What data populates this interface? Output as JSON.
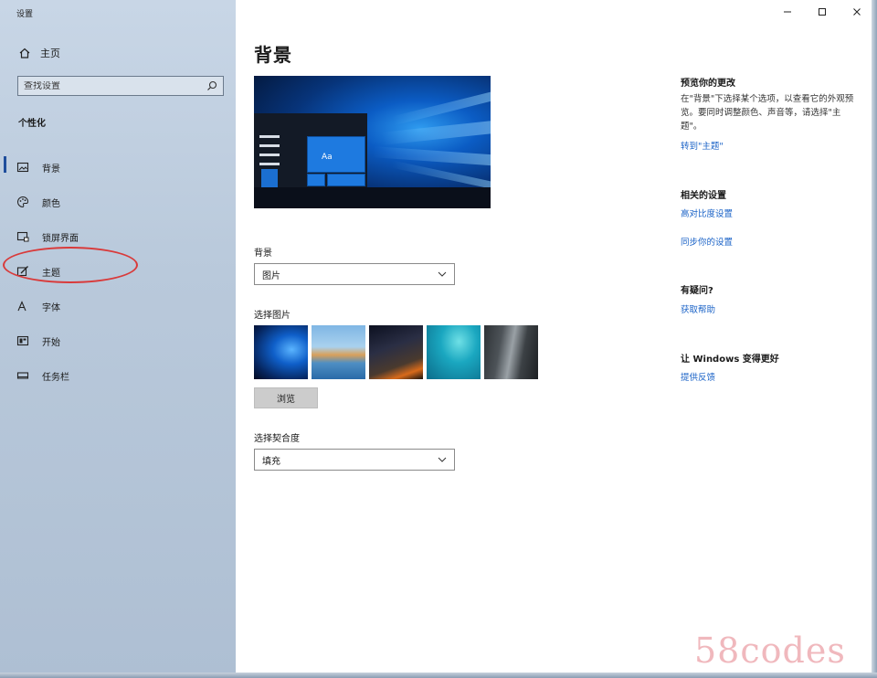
{
  "window": {
    "title": "设置"
  },
  "sidebar": {
    "home_label": "主页",
    "search_placeholder": "查找设置",
    "section_title": "个性化",
    "items": [
      {
        "label": "背景",
        "icon": "picture-icon",
        "active": true
      },
      {
        "label": "颜色",
        "icon": "palette-icon"
      },
      {
        "label": "锁屏界面",
        "icon": "lock-screen-icon"
      },
      {
        "label": "主题",
        "icon": "brush-icon"
      },
      {
        "label": "字体",
        "icon": "font-icon"
      },
      {
        "label": "开始",
        "icon": "start-icon"
      },
      {
        "label": "任务栏",
        "icon": "taskbar-icon"
      }
    ]
  },
  "main": {
    "title": "背景",
    "preview_tile_text": "Aa",
    "background_label": "背景",
    "background_value": "图片",
    "choose_picture_label": "选择图片",
    "browse_label": "浏览",
    "fit_label": "选择契合度",
    "fit_value": "填充"
  },
  "right": {
    "preview_heading": "预览你的更改",
    "preview_text": "在\"背景\"下选择某个选项，以查看它的外观预览。要同时调整颜色、声音等，请选择\"主题\"。",
    "themes_link": "转到\"主题\"",
    "related_heading": "相关的设置",
    "contrast_link": "高对比度设置",
    "sync_link": "同步你的设置",
    "question_heading": "有疑问?",
    "help_link": "获取帮助",
    "better_heading": "让 Windows 变得更好",
    "feedback_link": "提供反馈"
  },
  "watermark": "58codes",
  "colors": {
    "accent": "#1b63c7",
    "annotation": "#d93a3a"
  }
}
